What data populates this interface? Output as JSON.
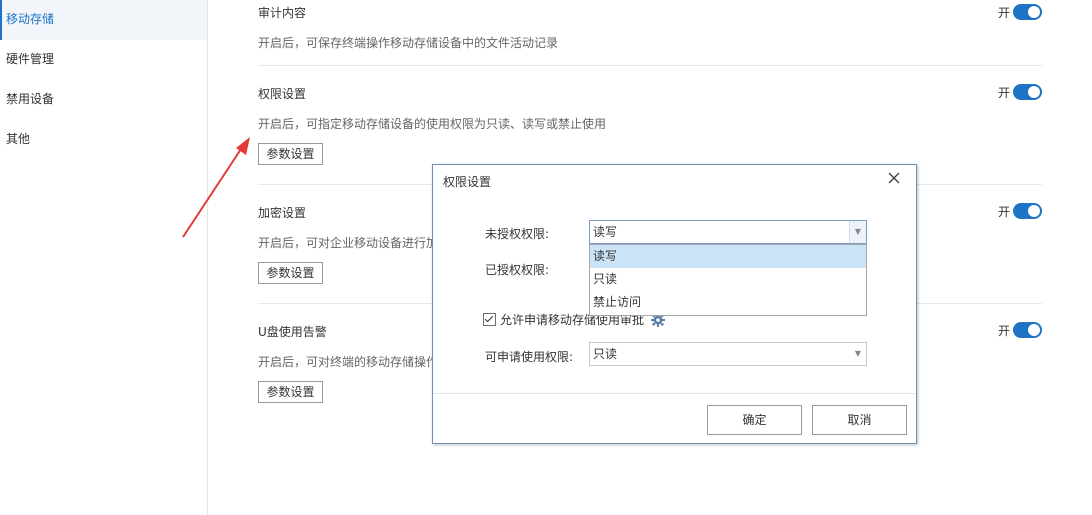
{
  "sidebar": {
    "items": [
      {
        "label": "移动存储",
        "active": true
      },
      {
        "label": "硬件管理",
        "active": false
      },
      {
        "label": "禁用设备",
        "active": false
      },
      {
        "label": "其他",
        "active": false
      }
    ]
  },
  "sections": [
    {
      "title": "审计内容",
      "desc": "开启后，可保存终端操作移动存储设备中的文件活动记录",
      "toggle": "开",
      "button": ""
    },
    {
      "title": "权限设置",
      "desc": "开启后，可指定移动存储设备的使用权限为只读、读写或禁止使用",
      "toggle": "开",
      "button": "参数设置"
    },
    {
      "title": "加密设置",
      "desc": "开启后，可对企业移动设备进行加",
      "toggle": "开",
      "button": "参数设置"
    },
    {
      "title": "U盘使用告警",
      "desc": "开启后，可对终端的移动存储操作",
      "toggle": "开",
      "button": "参数设置"
    }
  ],
  "dialog": {
    "title": "权限设置",
    "close_icon": "close-icon",
    "unauth_label": "未授权权限:",
    "unauth_value": "读写",
    "auth_label": "已授权权限:",
    "dropdown_options": [
      "读写",
      "只读",
      "禁止访问"
    ],
    "dropdown_selected": "读写",
    "allow_apply_label": "允许申请移动存储使用审批",
    "allow_apply_checked": true,
    "apply_perm_label": "可申请使用权限:",
    "apply_perm_value": "只读",
    "ok_label": "确定",
    "cancel_label": "取消"
  },
  "colors": {
    "accent": "#1a73c9",
    "toggle_on": "#1f73c4",
    "arrow": "#e53935",
    "dropdown_highlight": "#cce4f7"
  }
}
